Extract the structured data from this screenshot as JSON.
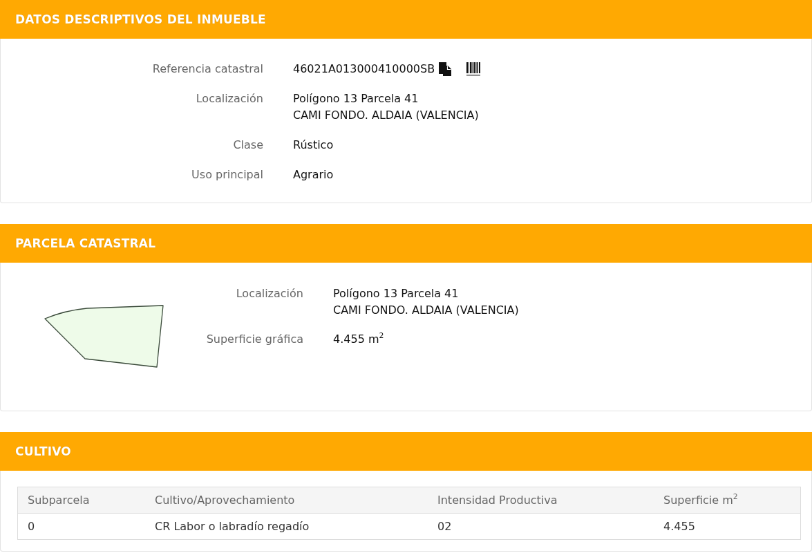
{
  "sections": [
    {
      "kind": "details",
      "title": "DATOS DESCRIPTIVOS DEL INMUEBLE",
      "fields": [
        {
          "kind": "reference",
          "label": "Referencia catastral",
          "lines": [
            "46021A013000410000SB"
          ]
        },
        {
          "kind": "text",
          "label": "Localización",
          "lines": [
            "Polígono 13 Parcela 41",
            "CAMI FONDO. ALDAIA (VALENCIA)"
          ]
        },
        {
          "kind": "text",
          "label": "Clase",
          "lines": [
            "Rústico"
          ]
        },
        {
          "kind": "text",
          "label": "Uso principal",
          "lines": [
            "Agrario"
          ]
        }
      ]
    },
    {
      "kind": "parcel",
      "title": "PARCELA CATASTRAL",
      "fields": [
        {
          "kind": "text",
          "label": "Localización",
          "lines": [
            "Polígono 13 Parcela 41",
            "CAMI FONDO. ALDAIA (VALENCIA)"
          ]
        },
        {
          "kind": "text",
          "label": "Superficie gráfica",
          "lines": [
            "4.455 m$^{2}$"
          ]
        }
      ]
    },
    {
      "kind": "table",
      "title": "CULTIVO",
      "columns": [
        "Subparcela",
        "Cultivo/Aprovechamiento",
        "Intensidad Productiva",
        "Superficie m$^{2}$"
      ],
      "rows": [
        [
          "0",
          "CR Labor o labradío regadío",
          "02",
          "4.455"
        ]
      ]
    }
  ]
}
